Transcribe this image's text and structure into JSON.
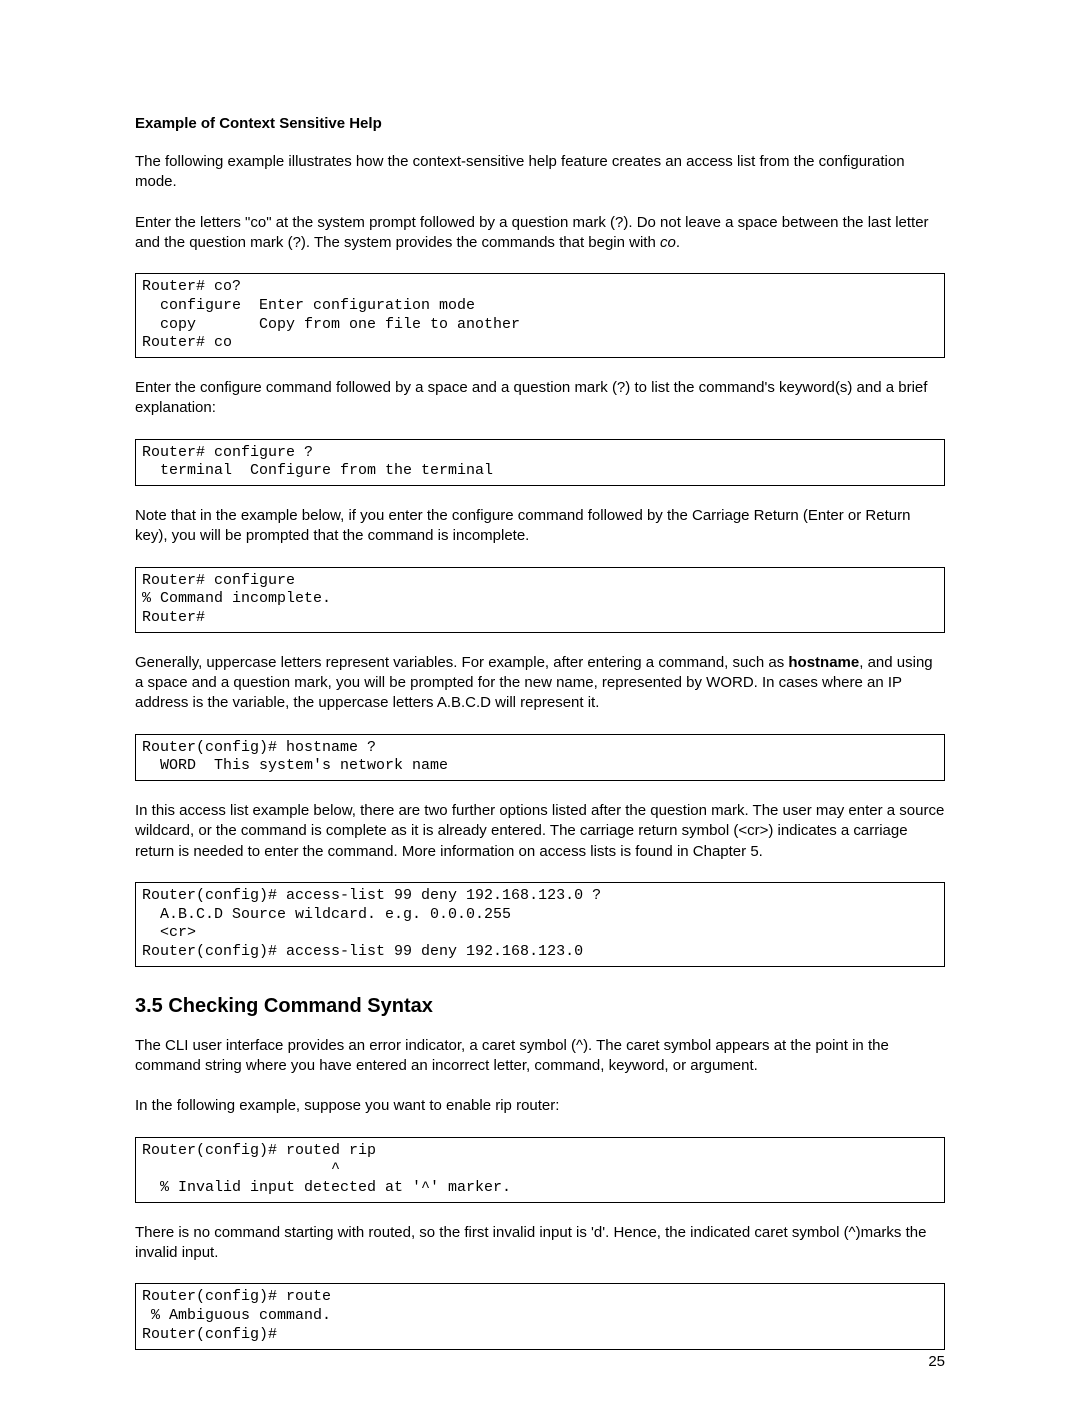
{
  "section_title": "Example of Context Sensitive Help",
  "para1": "The following example illustrates how the context-sensitive help feature creates an access list from the configuration mode.",
  "para2_a": "Enter the letters \"co\" at the system prompt followed by a question mark (?). Do not leave a space between the last letter and the question mark (?). The system provides the commands that begin with ",
  "para2_italic": "co",
  "para2_b": ".",
  "code1": "Router# co?\n  configure  Enter configuration mode\n  copy       Copy from one file to another\nRouter# co",
  "para3": "Enter the configure command followed by a space and a question mark (?) to list the command's keyword(s) and a brief explanation:",
  "code2": "Router# configure ?\n  terminal  Configure from the terminal",
  "para4": "Note that in the example below, if you enter the configure command followed by the Carriage Return (Enter or Return key), you will be prompted that the command is incomplete.",
  "code3": "Router# configure\n% Command incomplete.\nRouter#",
  "para5_a": "Generally, uppercase letters represent variables. For example, after entering a command, such as ",
  "para5_bold": "hostname",
  "para5_b": ", and using a space and a question mark, you will be prompted for the new name, represented by WORD. In cases where an IP address is the variable, the uppercase letters A.B.C.D will represent it.",
  "code4": "Router(config)# hostname ?\n  WORD  This system's network name",
  "para6": "In this access list example below, there are two further options listed after the question mark. The user may enter a source wildcard, or the command is complete as it is already entered. The carriage return symbol (<cr>) indicates a carriage return is needed to enter the command. More information on access lists is found in Chapter 5.",
  "code5": "Router(config)# access-list 99 deny 192.168.123.0 ?\n  A.B.C.D Source wildcard. e.g. 0.0.0.255\n  <cr>\nRouter(config)# access-list 99 deny 192.168.123.0",
  "heading": "3.5 Checking Command Syntax",
  "para7": "The CLI user interface provides an error indicator, a caret symbol (^). The caret symbol appears at the point in the command string where you have entered an incorrect letter, command, keyword, or argument.",
  "para8": "In the following example, suppose you want to enable rip router:",
  "code6": "Router(config)# routed rip\n                     ^\n  % Invalid input detected at '^' marker.",
  "para9": "There is no command starting with routed, so the first invalid input is 'd'. Hence, the indicated caret symbol (^)marks the invalid input.",
  "code7": "Router(config)# route\n % Ambiguous command.\nRouter(config)#",
  "page_number": "25"
}
